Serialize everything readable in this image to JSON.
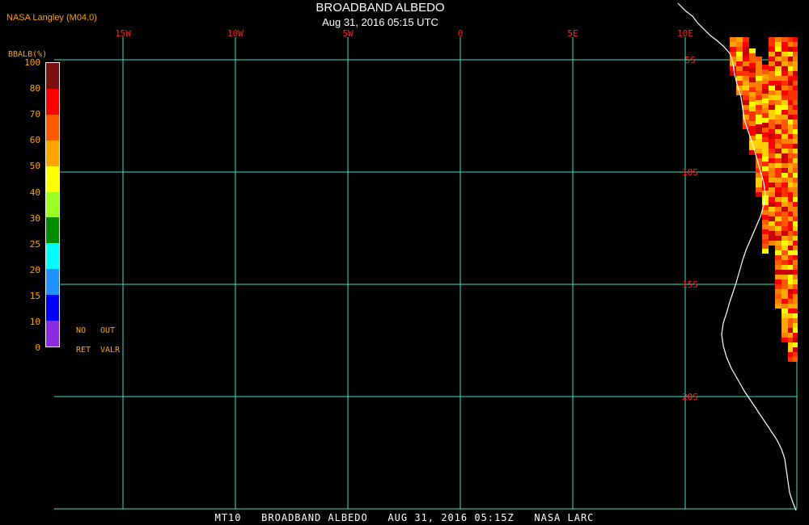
{
  "header": {
    "producer": "NASA Langley (M04.0)",
    "title": "BROADBAND ALBEDO",
    "datetime": "Aug 31, 2016 05:15 UTC"
  },
  "colorbar": {
    "title": "BBALB(%)",
    "ticks": [
      "100",
      "80",
      "70",
      "60",
      "50",
      "40",
      "30",
      "25",
      "20",
      "15",
      "10",
      "0"
    ],
    "colors": [
      "#7a0f0f",
      "#ff0000",
      "#ff5a00",
      "#ffa500",
      "#ffff00",
      "#9aff20",
      "#008c00",
      "#00ffff",
      "#1e90ff",
      "#0000ff",
      "#8a2be2"
    ],
    "no_ret_label_1": "NO",
    "no_ret_label_2": "RET",
    "out_valr_label_1": "OUT",
    "out_valr_label_2": "VALR"
  },
  "map": {
    "longitude_labels": [
      "15W",
      "10W",
      "5W",
      "0",
      "5E",
      "10E"
    ],
    "latitude_labels": [
      "5S",
      "10S",
      "15S",
      "20S"
    ],
    "grid_color": "#40e0d0",
    "label_color": "#ff2020",
    "coastline_color": "#ffffff"
  },
  "footer": {
    "text": "MT10   BROADBAND ALBEDO   AUG 31, 2016 05:15Z   NASA LARC"
  }
}
